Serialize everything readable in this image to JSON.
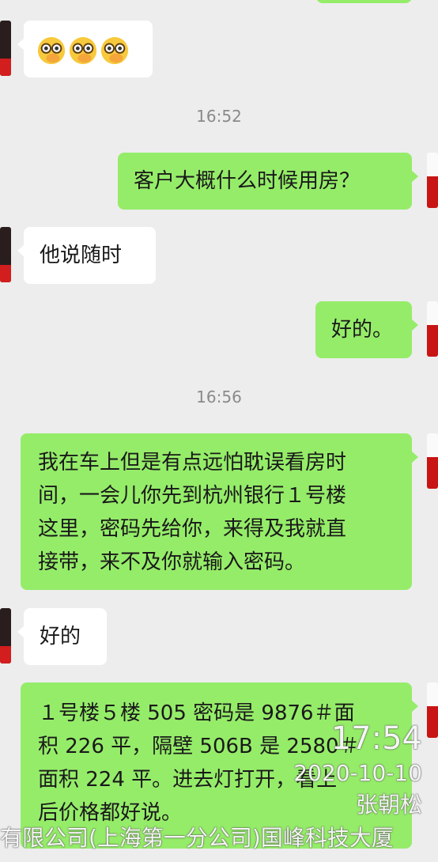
{
  "chat": {
    "times": [
      "16:52",
      "16:56"
    ],
    "messages": [
      {
        "from": "other",
        "type": "emoji",
        "emoji": [
          "face-with-monocle",
          "face-with-monocle",
          "face-with-monocle"
        ]
      },
      {
        "from": "me",
        "text": "客户大概什么时候用房？"
      },
      {
        "from": "other",
        "text": "他说随时"
      },
      {
        "from": "me",
        "text": "好的。"
      },
      {
        "from": "me",
        "lines": [
          "我在车上但是有点远怕耽误看房时",
          "间，一会儿你先到杭州银行１号楼",
          "这里，密码先给你，来得及我就直",
          "接带，来不及你就输入密码。"
        ]
      },
      {
        "from": "other",
        "text": "好的"
      },
      {
        "from": "me",
        "lines": [
          "１号楼５楼 505 密码是 9876＃面",
          "积 226 平，隔壁 506B 是 2580＃",
          "面积 224 平。进去灯打开，看上",
          "后价格都好说。"
        ]
      }
    ]
  },
  "watermark": {
    "time": "17:54",
    "date": "2020-10-10",
    "name": "张朝松",
    "company": "有限公司(上海第一分公司)国峰科技大厦"
  },
  "colors": {
    "background": "#ededed",
    "outgoing": "#95ec69",
    "incoming": "#ffffff"
  }
}
